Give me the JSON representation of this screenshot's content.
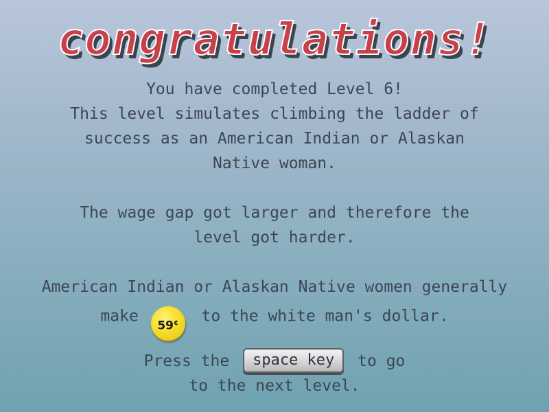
{
  "title": "congratulations!",
  "message": {
    "line1": "You have completed Level 6!",
    "line2": "This level simulates climbing the ladder of",
    "line3": "success as an American Indian or Alaskan",
    "line4": "Native woman.",
    "line5": "The wage gap got larger and therefore the",
    "line6": "level got harder.",
    "line7": "American Indian or Alaskan Native women generally",
    "line8_before": "make",
    "line8_after": "to the white man's dollar."
  },
  "coin": {
    "value": "59",
    "unit": "¢",
    "color": "#f7de2a"
  },
  "prompt": {
    "before": "Press the",
    "key_label": "space key",
    "after": "to go",
    "line2": "to the next level."
  },
  "colors": {
    "title": "#c8404a",
    "text": "#3d4653",
    "background_top": "#b9c6dc",
    "background_bottom": "#6fa2b0"
  }
}
